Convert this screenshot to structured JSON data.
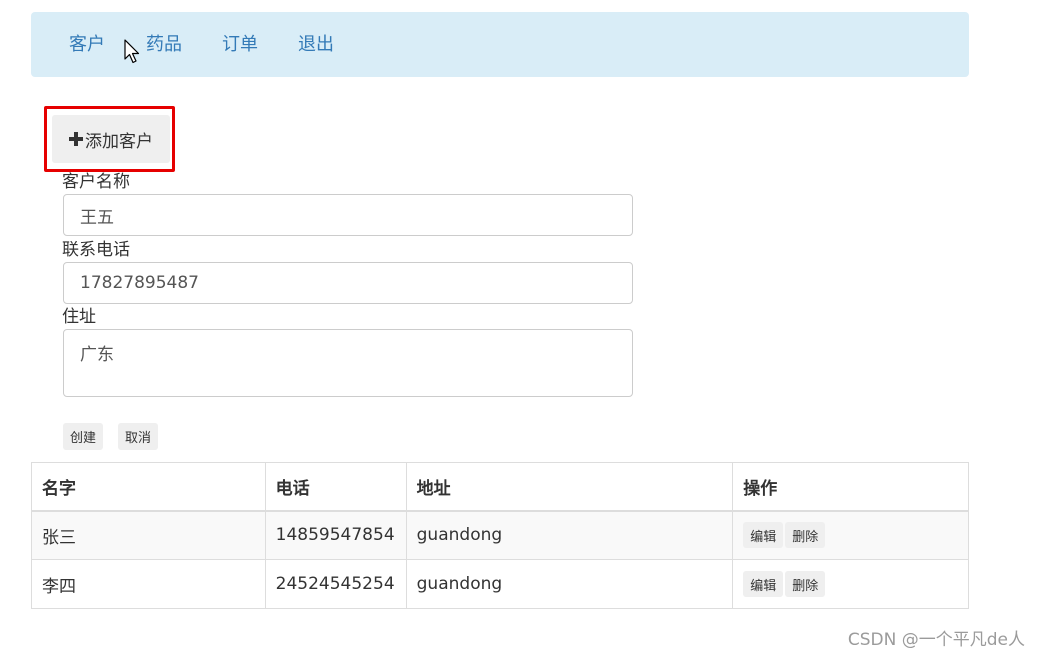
{
  "nav": {
    "items": [
      {
        "label": "客户"
      },
      {
        "label": "药品"
      },
      {
        "label": "订单"
      },
      {
        "label": "退出"
      }
    ]
  },
  "add_button": {
    "icon": "plus-icon",
    "label": "添加客户"
  },
  "form": {
    "name_label": "客户名称",
    "name_value": "王五",
    "phone_label": "联系电话",
    "phone_value": "17827895487",
    "address_label": "住址",
    "address_value": "广东",
    "create_label": "创建",
    "cancel_label": "取消"
  },
  "table": {
    "headers": [
      "名字",
      "电话",
      "地址",
      "操作"
    ],
    "rows": [
      {
        "name": "张三",
        "phone": "14859547854",
        "address": "guandong",
        "edit": "编辑",
        "delete": "删除"
      },
      {
        "name": "李四",
        "phone": "24524545254",
        "address": "guandong",
        "edit": "编辑",
        "delete": "删除"
      }
    ]
  },
  "colors": {
    "nav_bg": "#d9edf7",
    "link": "#337ab7",
    "highlight_border": "#e60000"
  },
  "watermark": "CSDN @一个平凡de人"
}
